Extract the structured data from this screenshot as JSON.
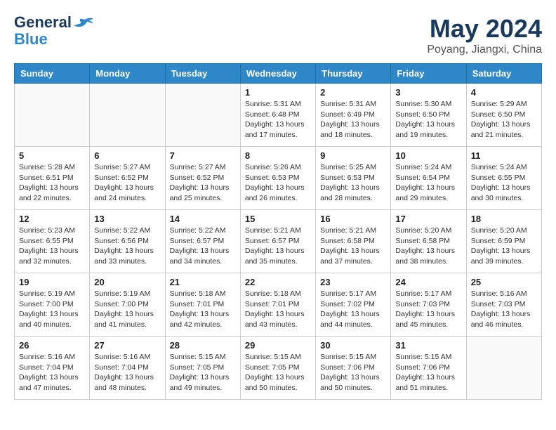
{
  "header": {
    "logo_line1": "General",
    "logo_line2": "Blue",
    "month": "May 2024",
    "location": "Poyang, Jiangxi, China"
  },
  "weekdays": [
    "Sunday",
    "Monday",
    "Tuesday",
    "Wednesday",
    "Thursday",
    "Friday",
    "Saturday"
  ],
  "weeks": [
    [
      {
        "day": "",
        "info": ""
      },
      {
        "day": "",
        "info": ""
      },
      {
        "day": "",
        "info": ""
      },
      {
        "day": "1",
        "info": "Sunrise: 5:31 AM\nSunset: 6:48 PM\nDaylight: 13 hours\nand 17 minutes."
      },
      {
        "day": "2",
        "info": "Sunrise: 5:31 AM\nSunset: 6:49 PM\nDaylight: 13 hours\nand 18 minutes."
      },
      {
        "day": "3",
        "info": "Sunrise: 5:30 AM\nSunset: 6:50 PM\nDaylight: 13 hours\nand 19 minutes."
      },
      {
        "day": "4",
        "info": "Sunrise: 5:29 AM\nSunset: 6:50 PM\nDaylight: 13 hours\nand 21 minutes."
      }
    ],
    [
      {
        "day": "5",
        "info": "Sunrise: 5:28 AM\nSunset: 6:51 PM\nDaylight: 13 hours\nand 22 minutes."
      },
      {
        "day": "6",
        "info": "Sunrise: 5:27 AM\nSunset: 6:52 PM\nDaylight: 13 hours\nand 24 minutes."
      },
      {
        "day": "7",
        "info": "Sunrise: 5:27 AM\nSunset: 6:52 PM\nDaylight: 13 hours\nand 25 minutes."
      },
      {
        "day": "8",
        "info": "Sunrise: 5:26 AM\nSunset: 6:53 PM\nDaylight: 13 hours\nand 26 minutes."
      },
      {
        "day": "9",
        "info": "Sunrise: 5:25 AM\nSunset: 6:53 PM\nDaylight: 13 hours\nand 28 minutes."
      },
      {
        "day": "10",
        "info": "Sunrise: 5:24 AM\nSunset: 6:54 PM\nDaylight: 13 hours\nand 29 minutes."
      },
      {
        "day": "11",
        "info": "Sunrise: 5:24 AM\nSunset: 6:55 PM\nDaylight: 13 hours\nand 30 minutes."
      }
    ],
    [
      {
        "day": "12",
        "info": "Sunrise: 5:23 AM\nSunset: 6:55 PM\nDaylight: 13 hours\nand 32 minutes."
      },
      {
        "day": "13",
        "info": "Sunrise: 5:22 AM\nSunset: 6:56 PM\nDaylight: 13 hours\nand 33 minutes."
      },
      {
        "day": "14",
        "info": "Sunrise: 5:22 AM\nSunset: 6:57 PM\nDaylight: 13 hours\nand 34 minutes."
      },
      {
        "day": "15",
        "info": "Sunrise: 5:21 AM\nSunset: 6:57 PM\nDaylight: 13 hours\nand 35 minutes."
      },
      {
        "day": "16",
        "info": "Sunrise: 5:21 AM\nSunset: 6:58 PM\nDaylight: 13 hours\nand 37 minutes."
      },
      {
        "day": "17",
        "info": "Sunrise: 5:20 AM\nSunset: 6:58 PM\nDaylight: 13 hours\nand 38 minutes."
      },
      {
        "day": "18",
        "info": "Sunrise: 5:20 AM\nSunset: 6:59 PM\nDaylight: 13 hours\nand 39 minutes."
      }
    ],
    [
      {
        "day": "19",
        "info": "Sunrise: 5:19 AM\nSunset: 7:00 PM\nDaylight: 13 hours\nand 40 minutes."
      },
      {
        "day": "20",
        "info": "Sunrise: 5:19 AM\nSunset: 7:00 PM\nDaylight: 13 hours\nand 41 minutes."
      },
      {
        "day": "21",
        "info": "Sunrise: 5:18 AM\nSunset: 7:01 PM\nDaylight: 13 hours\nand 42 minutes."
      },
      {
        "day": "22",
        "info": "Sunrise: 5:18 AM\nSunset: 7:01 PM\nDaylight: 13 hours\nand 43 minutes."
      },
      {
        "day": "23",
        "info": "Sunrise: 5:17 AM\nSunset: 7:02 PM\nDaylight: 13 hours\nand 44 minutes."
      },
      {
        "day": "24",
        "info": "Sunrise: 5:17 AM\nSunset: 7:03 PM\nDaylight: 13 hours\nand 45 minutes."
      },
      {
        "day": "25",
        "info": "Sunrise: 5:16 AM\nSunset: 7:03 PM\nDaylight: 13 hours\nand 46 minutes."
      }
    ],
    [
      {
        "day": "26",
        "info": "Sunrise: 5:16 AM\nSunset: 7:04 PM\nDaylight: 13 hours\nand 47 minutes."
      },
      {
        "day": "27",
        "info": "Sunrise: 5:16 AM\nSunset: 7:04 PM\nDaylight: 13 hours\nand 48 minutes."
      },
      {
        "day": "28",
        "info": "Sunrise: 5:15 AM\nSunset: 7:05 PM\nDaylight: 13 hours\nand 49 minutes."
      },
      {
        "day": "29",
        "info": "Sunrise: 5:15 AM\nSunset: 7:05 PM\nDaylight: 13 hours\nand 50 minutes."
      },
      {
        "day": "30",
        "info": "Sunrise: 5:15 AM\nSunset: 7:06 PM\nDaylight: 13 hours\nand 50 minutes."
      },
      {
        "day": "31",
        "info": "Sunrise: 5:15 AM\nSunset: 7:06 PM\nDaylight: 13 hours\nand 51 minutes."
      },
      {
        "day": "",
        "info": ""
      }
    ]
  ]
}
